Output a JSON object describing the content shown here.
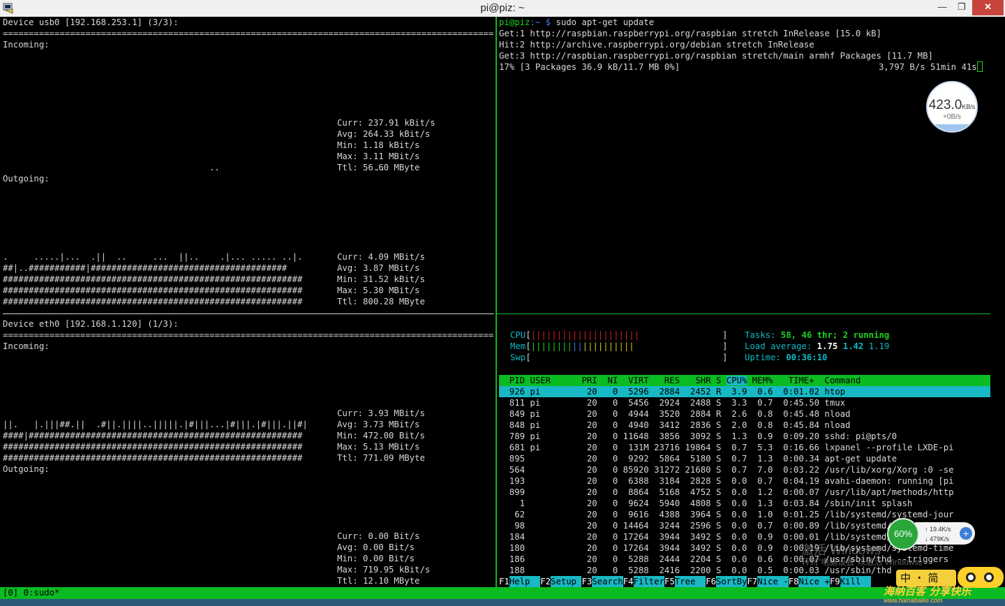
{
  "window": {
    "title": "pi@piz: ~",
    "minimize_glyph": "—",
    "maximize_glyph": "❐",
    "close_glyph": "✕"
  },
  "nload_usb0": {
    "header": "Device usb0 [192.168.253.1] (3/3):",
    "rule": "===============================================================================================================================",
    "incoming_label": "Incoming:",
    "incoming_graph": "                                        ..                              ..",
    "incoming_stats": "Curr: 237.91 kBit/s\nAvg: 264.33 kBit/s\nMin: 1.18 kBit/s\nMax: 3.11 MBit/s\nTtl: 56.60 MByte",
    "outgoing_label": "Outgoing:",
    "outgoing_graph": ".     .....|...  .||  ..     ...  ||..    .|... ..... ..|.\n##|..###########|######################################\n##########################################################\n##########################################################\n##########################################################",
    "outgoing_stats": "Curr: 4.09 MBit/s\nAvg: 3.87 MBit/s\nMin: 31.52 kBit/s\nMax: 5.30 MBit/s\nTtl: 800.28 MByte"
  },
  "nload_eth0": {
    "header": "Device eth0 [192.168.1.120] (1/3):",
    "rule": "===============================================================================================================================",
    "incoming_label": "Incoming:",
    "incoming_graph": "||.   |.|||##.||  .#||.||||..|||||.|#|||...|#|||.|#|||.||#|\n####|#####################################################\n##########################################################\n##########################################################",
    "incoming_stats": "Curr: 3.93 MBit/s\nAvg: 3.73 MBit/s\nMin: 472.00 Bit/s\nMax: 5.13 MBit/s\nTtl: 771.09 MByte",
    "outgoing_label": "Outgoing:",
    "outgoing_stats": "Curr: 0.00 Bit/s\nAvg: 0.00 Bit/s\nMin: 0.00 Bit/s\nMax: 719.95 kBit/s\nTtl: 12.10 MByte"
  },
  "apt_pane": {
    "prompt_user": "pi@piz",
    "prompt_path": ":~ $",
    "command": " sudo apt-get update",
    "output": "Get:1 http://raspbian.raspberrypi.org/raspbian stretch InRelease [15.0 kB]\nHit:2 http://archive.raspberrypi.org/debian stretch InRelease\nGet:3 http://raspbian.raspberrypi.org/raspbian stretch/main armhf Packages [11.7 MB]",
    "progress_left": "17% [3 Packages 36.9 kB/11.7 MB 0%]",
    "progress_right": "3,797 B/s 51min 41s"
  },
  "htop": {
    "cpu_label": "CPU",
    "cpu_bar": "|||||||||||||||||||||",
    "mem_label": "Mem",
    "mem_bar_green": "||||||||",
    "mem_bar_blue": "||",
    "mem_bar_yellow": "||||||||||",
    "swp_label": "Swp",
    "tasks_label": "Tasks: ",
    "tasks_value": "58, 46 thr; 2 running",
    "load_label": "Load average: ",
    "load_1": "1.75",
    "load_5": "1.42",
    "load_15": "1.19",
    "uptime_label": "Uptime: ",
    "uptime_value": "00:36:10",
    "header_row": "  PID USER      PRI  NI  VIRT   RES   SHR S ",
    "header_cpu": "CPU%",
    "header_rest": " MEM%   TIME+  Command",
    "selected_row": "  926 pi         20   0  5296  2884  2452 R  3.9  0.6  0:01.02 htop",
    "rows": "  811 pi         20   0  5456  2924  2488 S  3.3  0.7  0:45.50 tmux\n  849 pi         20   0  4944  3520  2884 R  2.6  0.8  0:45.48 nload\n  848 pi         20   0  4940  3412  2836 S  2.0  0.8  0:45.84 nload\n  789 pi         20   0 11648  3856  3092 S  1.3  0.9  0:09.20 sshd: pi@pts/0\n  681 pi         20   0  131M 23716 19864 S  0.7  5.3  0:16.66 lxpanel --profile LXDE-pi\n  895            20   0  9292  5864  5180 S  0.7  1.3  0:00.34 apt-get update\n  564            20   0 85920 31272 21680 S  0.7  7.0  0:03.22 /usr/lib/xorg/Xorg :0 -se\n  193            20   0  6388  3184  2828 S  0.0  0.7  0:04.19 avahi-daemon: running [pi\n  899            20   0  8864  5168  4752 S  0.0  1.2  0:00.07 /usr/lib/apt/methods/http\n    1            20   0  9624  5940  4808 S  0.0  1.3  0:03.84 /sbin/init splash\n   62            20   0  9616  4388  3964 S  0.0  1.0  0:01.25 /lib/systemd/systemd-jour\n   98            20   0 14464  3244  2596 S  0.0  0.7  0:00.89 /lib/systemd/systemd-udev\n  184            20   0 17264  3944  3492 S  0.0  0.9  0:00.01 /lib/systemd/systemd-time\n  180            20   0 17264  3944  3492 S  0.0  0.9  0:00.19 /lib/systemd/systemd-time\n  186            20   0  5288  2444  2204 S  0.0  0.6  0:00.07 /usr/sbin/thd --triggers\n  188            20   0  5288  2416  2200 S  0.0  0.5  0:00.03 /usr/sbin/thd",
    "fkeys": [
      {
        "key": "F1",
        "label": "Help  "
      },
      {
        "key": "F2",
        "label": "Setup "
      },
      {
        "key": "F3",
        "label": "Search"
      },
      {
        "key": "F4",
        "label": "Filter"
      },
      {
        "key": "F5",
        "label": "Tree  "
      },
      {
        "key": "F6",
        "label": "SortBy"
      },
      {
        "key": "F7",
        "label": "Nice -"
      },
      {
        "key": "F8",
        "label": "Nice +"
      },
      {
        "key": "F9",
        "label": "Kill  "
      }
    ]
  },
  "tmux_status": "[0] 0:sudo*",
  "overlays": {
    "speed_value": "423.0",
    "speed_unit": "KB/s",
    "speed_sub": "+0B/s",
    "widget_percent": "60%",
    "widget_up": "↑ 19.4K/s",
    "widget_down": "↓ 479K/s",
    "widget_plus": "+",
    "watermark_line1": "激活 Windows",
    "watermark_line2": "转到\"电脑设置\"以激活 Windows。",
    "ime_text": "中 ・ 简",
    "brand_text": "海纳百客 分享快乐",
    "brand_url": "www.hainabaike.com"
  }
}
